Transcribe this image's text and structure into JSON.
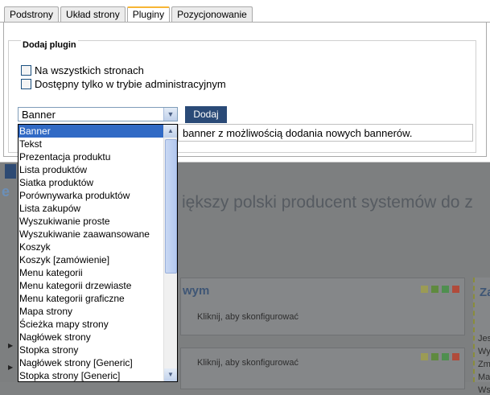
{
  "tabs": [
    "Podstrony",
    "Układ strony",
    "Pluginy",
    "Pozycjonowanie"
  ],
  "active_tab": "Pluginy",
  "fieldset": {
    "legend": "Dodaj plugin"
  },
  "options_check": [
    {
      "label": "Na wszystkich stronach",
      "checked": false
    },
    {
      "label": "Dostępny tylko w trybie administracyjnym",
      "checked": false
    }
  ],
  "plugin_select": {
    "selected": "Banner",
    "options": [
      "Banner",
      "Tekst",
      "Prezentacja produktu",
      "Lista produktów",
      "Siatka produktów",
      "Porównywarka produktów",
      "Lista zakupów",
      "Wyszukiwanie proste",
      "Wyszukiwanie zaawansowane",
      "Koszyk",
      "Koszyk [zamówienie]",
      "Menu kategorii",
      "Menu kategorii drzewiaste",
      "Menu kategorii graficzne",
      "Mapa strony",
      "Ścieżka mapy strony",
      "Nagłówek strony",
      "Stopka strony",
      "Nagłówek strony [Generic]",
      "Stopka strony [Generic]"
    ]
  },
  "add_button": "Dodaj",
  "description": "banner z możliwością dodania nowych bannerów.",
  "background": {
    "headline": "iększy polski producent systemów do z",
    "panel_title": "wym",
    "panel_text": "Kliknij, aby skonfigurować",
    "panel2_text": "Kliknij, aby skonfigurować",
    "right_title": "Za",
    "right_lines": [
      "Jes",
      "Wy",
      "Zm",
      "Ma",
      "Ws"
    ]
  },
  "colors": {
    "accent_tab": "#f7b534",
    "button": "#2a4a77",
    "selected": "#316ac5"
  }
}
